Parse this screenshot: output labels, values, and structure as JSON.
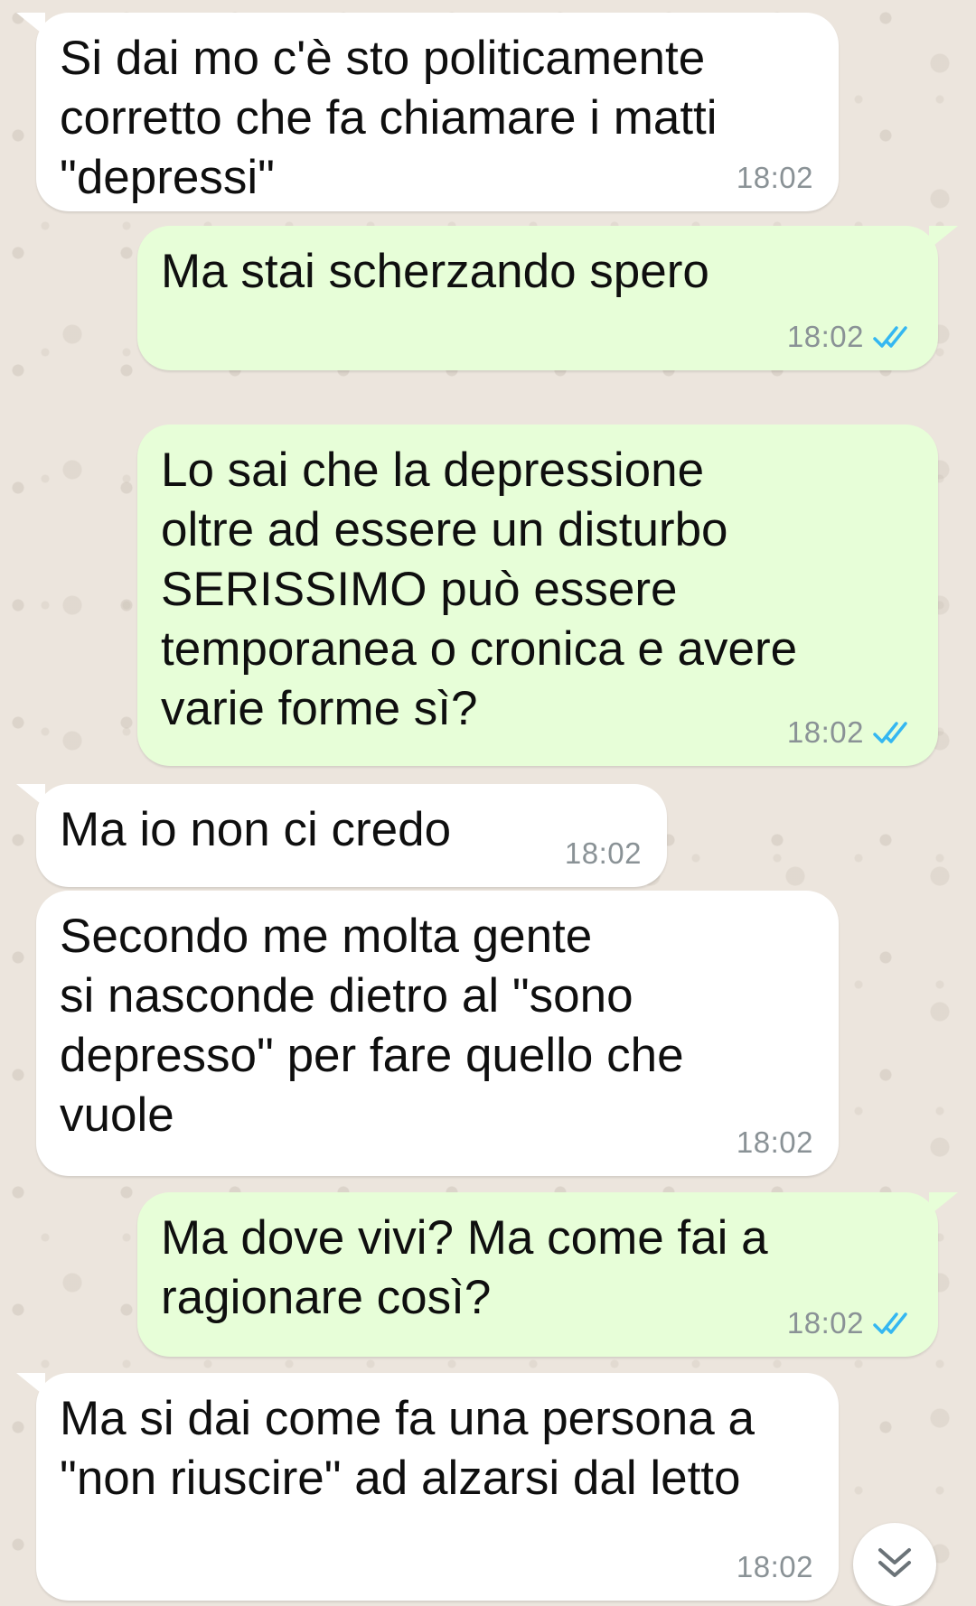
{
  "colors": {
    "incoming_bubble": "#ffffff",
    "outgoing_bubble": "#e7fed8",
    "chat_background": "#ece5dd",
    "read_ticks": "#34b7f1",
    "timestamp": "#8a9296"
  },
  "messages": [
    {
      "direction": "incoming",
      "text": "Si dai mo c'è sto politicamente\ncorretto che fa chiamare i matti\n\"depressi\"",
      "time": "18:02"
    },
    {
      "direction": "outgoing",
      "text": "Ma stai scherzando spero",
      "time": "18:02",
      "status_icon": "double-check-read-icon"
    },
    {
      "direction": "outgoing",
      "text": "Lo sai che la depressione\noltre ad essere un disturbo\nSERISSIMO può essere\ntemporanea o cronica e avere\nvarie forme sì?",
      "time": "18:02",
      "status_icon": "double-check-read-icon"
    },
    {
      "direction": "incoming",
      "text": "Ma io non ci credo",
      "time": "18:02"
    },
    {
      "direction": "incoming",
      "text": "Secondo me molta gente\nsi nasconde dietro al \"sono\ndepresso\" per fare quello che\nvuole",
      "time": "18:02"
    },
    {
      "direction": "outgoing",
      "text": "Ma dove vivi? Ma come fai a\nragionare così?",
      "time": "18:02",
      "status_icon": "double-check-read-icon"
    },
    {
      "direction": "incoming",
      "text": "Ma si dai come fa una persona a\n\"non riuscire\" ad alzarsi dal letto",
      "time": "18:02"
    }
  ],
  "scroll_button": {
    "icon": "double-chevron-down-icon"
  }
}
